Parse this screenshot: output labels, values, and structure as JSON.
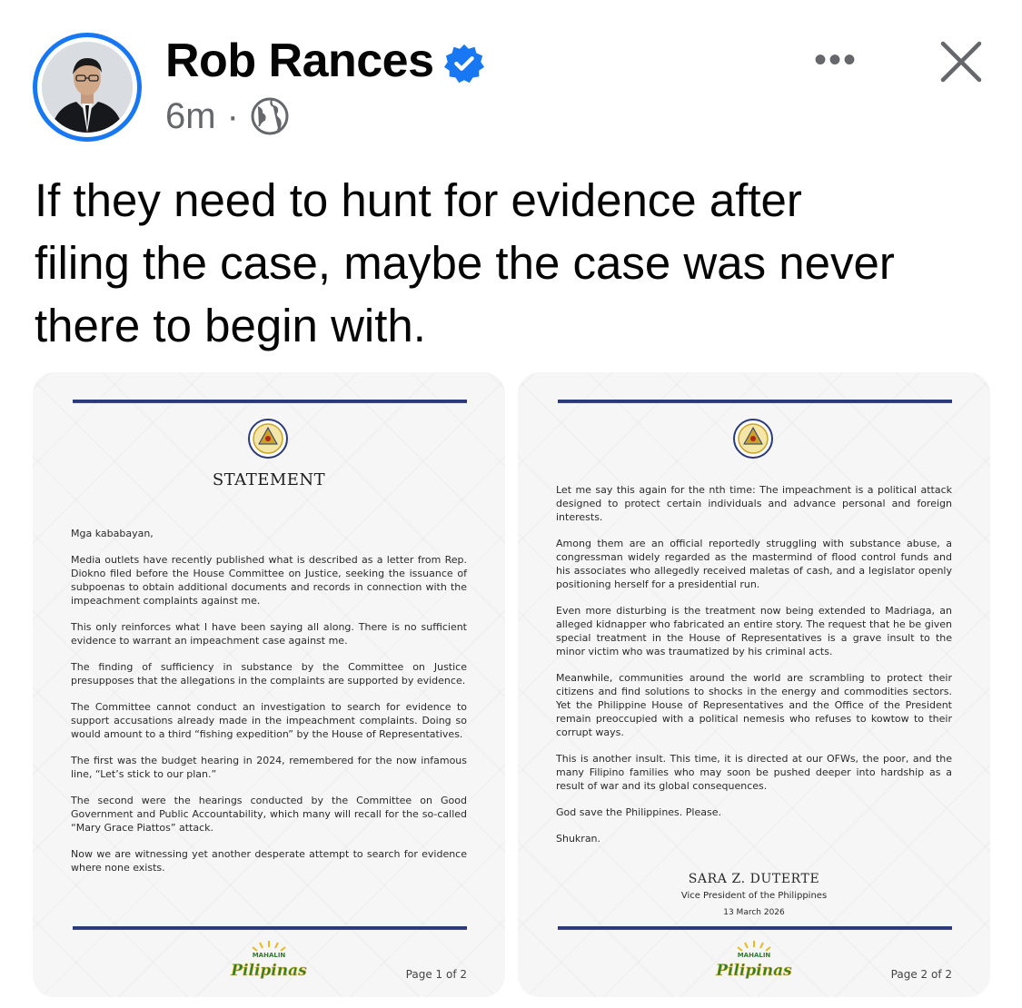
{
  "post": {
    "author": "Rob Rances",
    "time": "6m",
    "separator": "·",
    "audience_icon": "globe-icon",
    "more_label": "•••",
    "caption": "If they need to hunt for evidence after\nfiling the case, maybe the case was never\nthere to begin with."
  },
  "colors": {
    "verified": "#1877f2",
    "avatar_ring": "#1877f2",
    "rule_blue": "#2a3a78",
    "rule_red": "#b3261e"
  },
  "doc1": {
    "title": "STATEMENT",
    "paragraphs": [
      "Mga kababayan,",
      "Media outlets have recently published what is described as a letter from Rep. Diokno filed before the House Committee on Justice, seeking the issuance of subpoenas to obtain additional documents and records in connection with the impeachment complaints against me.",
      "This only reinforces what I have been saying all along. There is no sufficient evidence to warrant an impeachment case against me.",
      "The finding of sufficiency in substance by the Committee on Justice presupposes that the allegations in the complaints are supported by evidence.",
      "The Committee cannot conduct an investigation to search for evidence to support accusations already made in the impeachment complaints. Doing so would amount to a third “fishing expedition” by the House of Representatives.",
      "The first was the budget hearing in 2024, remembered for the now infamous line, “Let’s stick to our plan.”",
      "The second were the hearings conducted by the Committee on Good Government and Public Accountability, which many will recall for the so-called “Mary Grace Piattos” attack.",
      "Now we are witnessing yet another desperate attempt to search for evidence where none exists."
    ],
    "page": "Page 1 of 2"
  },
  "doc2": {
    "paragraphs": [
      "Let me say this again for the nth time: The impeachment is a political attack designed to protect certain individuals and advance personal and foreign interests.",
      "Among them are an official reportedly struggling with substance abuse, a congressman widely regarded as the mastermind of flood control funds and his associates who allegedly received maletas of cash, and a legislator openly positioning herself for a presidential run.",
      "Even more disturbing is the treatment now being extended to Madriaga, an alleged kidnapper who fabricated an entire story. The request that he be given special treatment in the House of Representatives is a grave insult to the minor victim who was traumatized by his criminal acts.",
      "Meanwhile, communities around the world are scrambling to protect their citizens and find solutions to shocks in the energy and commodities sectors. Yet the Philippine House of Representatives and the Office of the President remain preoccupied with a political nemesis who refuses to kowtow to their corrupt ways.",
      "This is another insult. This time, it is directed at our OFWs, the poor, and the many Filipino families who may soon be pushed deeper into hardship as a result of war and its global consequences.",
      "God save the Philippines. Please.",
      "Shukran."
    ],
    "signature_name": "SARA Z. DUTERTE",
    "signature_title": "Vice President of the Philippines",
    "date": "13 March 2026",
    "page": "Page 2 of 2"
  },
  "logo": {
    "top": "MAHALIN",
    "main": "Pilipinas"
  }
}
